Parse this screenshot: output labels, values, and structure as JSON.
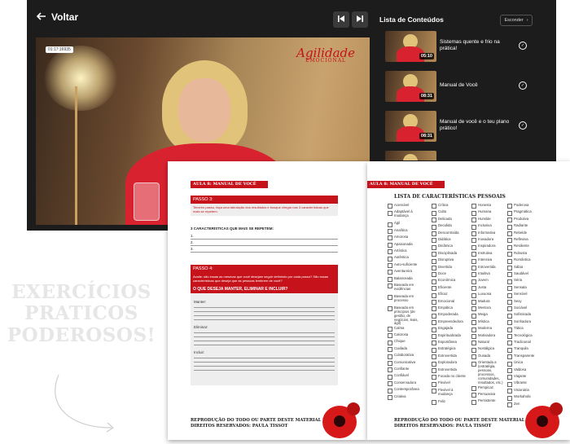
{
  "player": {
    "back_label": "Voltar",
    "prev_icon": "skip-previous-icon",
    "next_icon": "skip-next-icon",
    "video_timestamp": "01:17:16935",
    "logo": {
      "title": "Agilidade",
      "subtitle": "EMOCIONAL"
    }
  },
  "sidebar": {
    "title": "Lista de Conteúdos",
    "hide_label": "Esconder",
    "items": [
      {
        "title": "Sistemas quente e frio na prática!",
        "duration": "05:10",
        "completed": true
      },
      {
        "title": "Manual de Você",
        "duration": "08:31",
        "completed": true
      },
      {
        "title": "Manual de você e o teu plano prático!",
        "duration": "08:31",
        "completed": true
      },
      {
        "title": "",
        "duration": "",
        "completed": false
      }
    ]
  },
  "worksheet_left": {
    "header": "AULA 8: MANUAL DE VOCÊ",
    "step3": {
      "title": "PASSO 3:",
      "text": "Terceiro passo, faça uma tabulação dos resultados e busque chegar nas 3 características que mais se repetem."
    },
    "repeat_title": "3 CARACTERÍSTICAS QUE MAIS SE REPETEM:",
    "repeat_items": [
      "1.",
      "2.",
      "3."
    ],
    "step4": {
      "title": "PASSO 4:",
      "text": "Avalie: são essas as mesmas que você desejam seguir definindo por cada passo? São essas características que deseja que as pessoas lembrem de você?",
      "question": "O QUE DESEJA MANTER, ELIMINAR E INCLUIR?"
    },
    "fields": [
      "Manter:",
      "Eliminar:",
      "Incluir:"
    ],
    "footer": [
      "REPRODUÇÃO DO TODO OU PARTE DESTE MATERIAL PROIBIDA!",
      "DIREITOS RESERVADOS: PAULA TISSOT"
    ]
  },
  "worksheet_right": {
    "header": "AULA 8: MANUAL DE VOCÊ",
    "list_title": "LISTA DE CARACTERÍSTICAS PESSOAIS",
    "columns": [
      [
        "Acessível",
        "Adaptável à mudança",
        "Ágil",
        "Analítica",
        "Amorosa",
        "Apaixonada",
        "Artística",
        "Autêntica",
        "Auto-suficiente",
        "Aventureira",
        "Balanceada",
        "Baseada em evidências",
        "Baseada em processo",
        "Baseada em princípios (de gestão, de negócios, leais, ágil)",
        "Calma",
        "Calorosa",
        "Chique",
        "Cuidada",
        "Colaborativa",
        "Comunicativa",
        "Confiante",
        "Confiável",
        "Conservadora",
        "Contemporânea",
        "Criativa"
      ],
      [
        "Crítica",
        "Culta",
        "Delicada",
        "Decidida",
        "Descontraída",
        "Didática",
        "Dinâmica",
        "Disciplinada",
        "Disruptiva",
        "Divertida",
        "Doce",
        "Econômica",
        "Eficiente",
        "Eficaz",
        "Emocional",
        "Empática",
        "Empoderada",
        "Empreendedora",
        "Engajada",
        "Espiritualizada",
        "Espontânea",
        "Estratégica",
        "Extrovertida",
        "Exploradora",
        "Extrovertida",
        "Focada no cliente",
        "Flexível",
        "Flexível à mudança",
        "Feliz"
      ],
      [
        "Honesta",
        "Humana",
        "Humilde",
        "Inclusiva",
        "Informativa",
        "Inovadora",
        "Inspiradora",
        "Instrutiva",
        "Intensiva",
        "Introvertida",
        "Intuitiva",
        "Jovem",
        "Justa",
        "Luxuosa",
        "Madura",
        "Mentora",
        "Meiga",
        "Mística",
        "Moderna",
        "Motivadora",
        "Natural",
        "Nostálgica",
        "Ousada",
        "Orientada a (estratégia, pessoas, processos, comunidades, resultados, etc.)",
        "Perspicaz",
        "Persuasiva",
        "Persistente"
      ],
      [
        "Poderosa",
        "Pragmática",
        "Produtiva",
        "Radiante",
        "Rebelde",
        "Reflexiva",
        "Resiliente",
        "Robusta",
        "Romântica",
        "Sábia",
        "Saudável",
        "Séria",
        "Sensata",
        "Sensível",
        "Sexy",
        "Sociável",
        "Sofisticada",
        "Sonhadora",
        "Tática",
        "Tecnológica",
        "Tradicional",
        "Tranquila",
        "Transparente",
        "Única",
        "Valdosa",
        "Viajante",
        "Vibrante",
        "Visionária",
        "Workaholic",
        "Zen"
      ]
    ],
    "footer": [
      "REPRODUÇÃO DO TODO OU PARTE DESTE MATERIAL PROIBIDA!",
      "DIREITOS RESERVADOS: PAULA TISSOT"
    ]
  },
  "promo": {
    "lines": [
      "EXERCÍCIOS",
      "PRATICOS",
      "PODEROSOS!"
    ]
  }
}
